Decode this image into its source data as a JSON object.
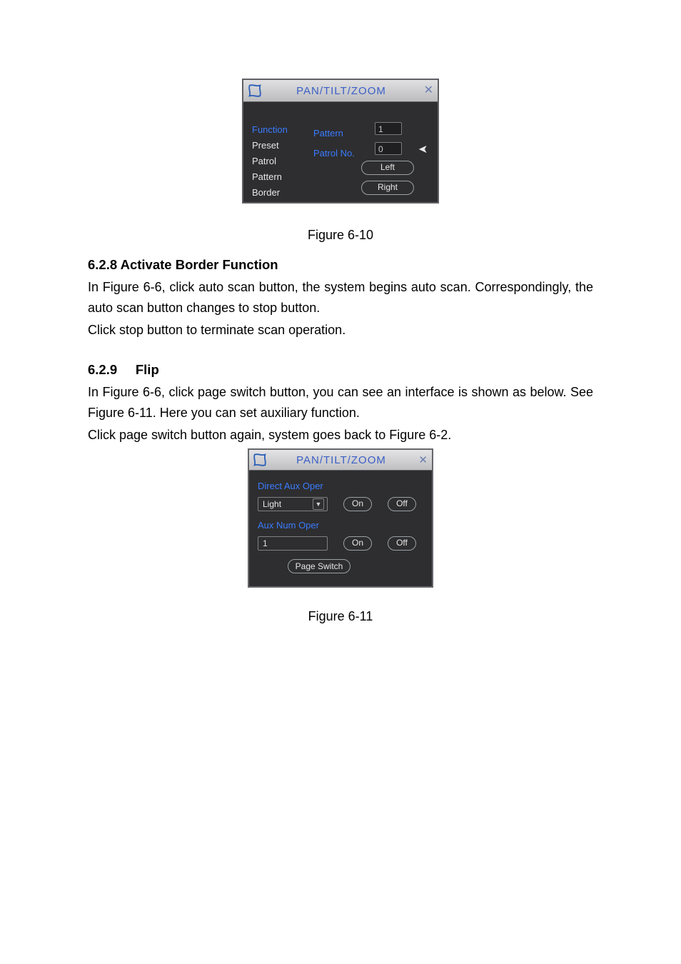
{
  "dialog1": {
    "title": "PAN/TILT/ZOOM",
    "left_items": [
      "Function",
      "Preset",
      "Patrol",
      "Pattern",
      "Border"
    ],
    "selected_index": 0,
    "mid_labels": {
      "pattern": "Pattern",
      "patrol_no": "Patrol No."
    },
    "pattern_value": "1",
    "patrol_value": "0",
    "btn_left": "Left",
    "btn_right": "Right"
  },
  "caption1": "Figure 6-10",
  "section1": {
    "heading": "6.2.8  Activate Border Function",
    "p1": "In Figure 6-6, click auto scan button, the system begins auto scan. Correspondingly, the auto scan button changes to stop button.",
    "p2": "Click stop button to terminate scan operation."
  },
  "section2": {
    "heading_no": "6.2.9",
    "heading_title": "Flip",
    "p1": "In Figure 6-6, click page switch button, you can see an interface is shown as below. See Figure 6-11. Here you can set auxiliary function.",
    "p2": "Click page switch button again, system goes back to Figure 6-2."
  },
  "dialog2": {
    "title": "PAN/TILT/ZOOM",
    "direct_label": "Direct Aux Oper",
    "direct_select_value": "Light",
    "aux_label": "Aux Num Oper",
    "aux_value": "1",
    "on_label": "On",
    "off_label": "Off",
    "page_switch": "Page Switch"
  },
  "caption2": "Figure 6-11"
}
